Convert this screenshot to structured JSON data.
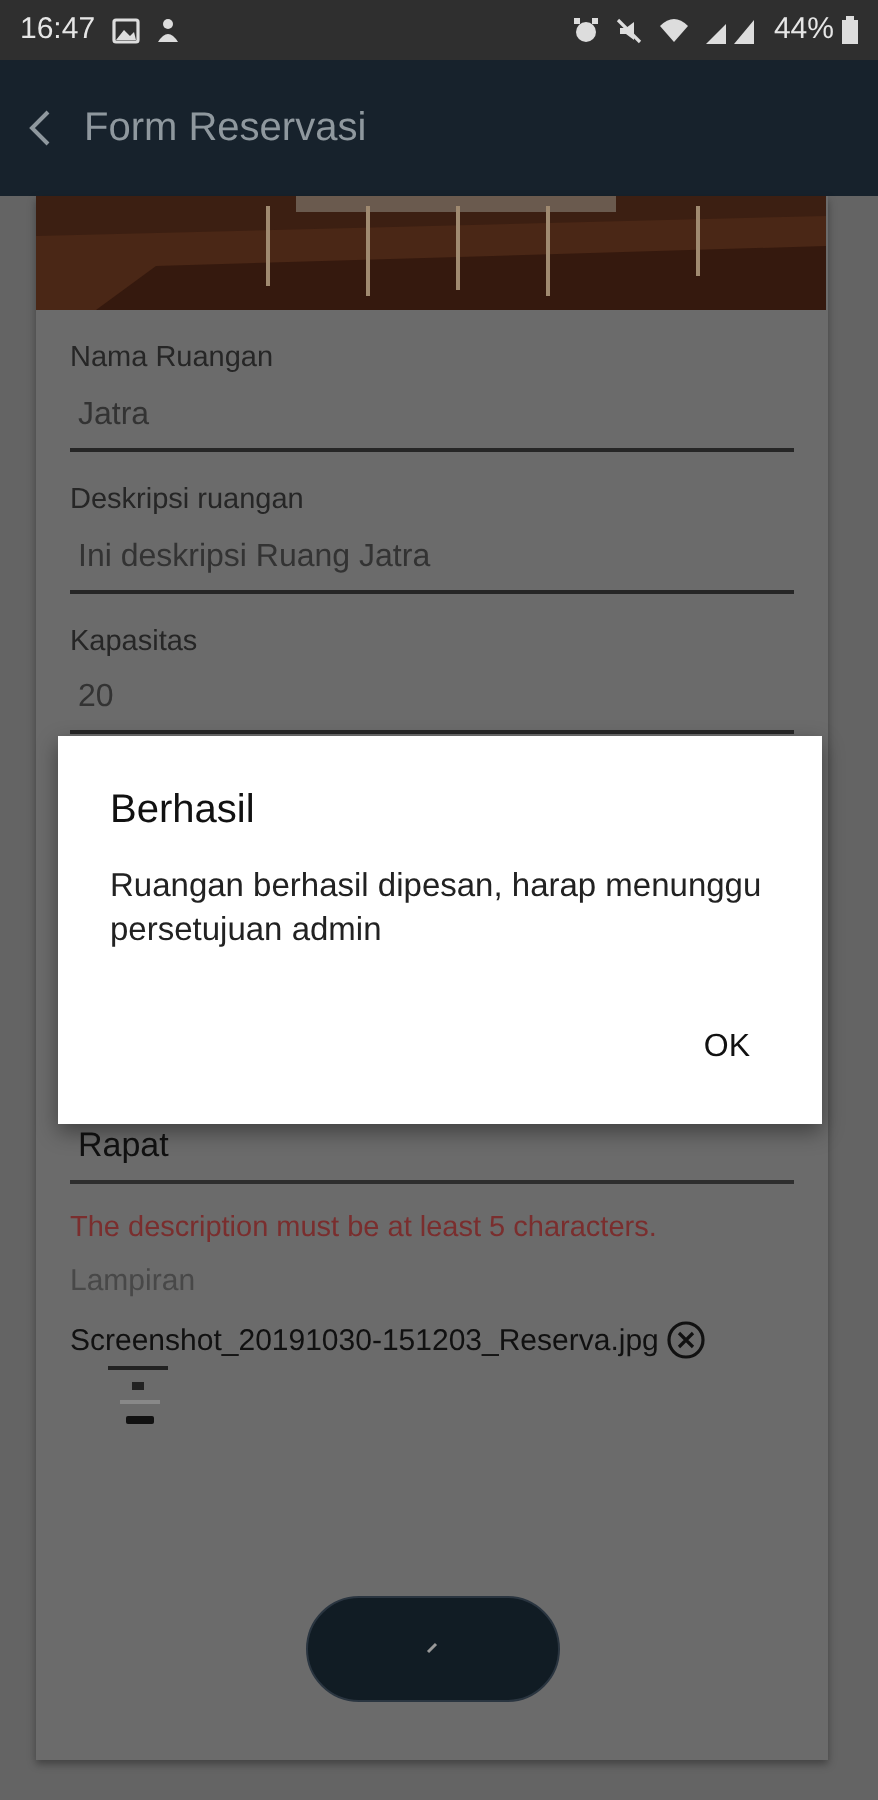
{
  "status_bar": {
    "time": "16:47",
    "battery": "44%"
  },
  "app_bar": {
    "title": "Form Reservasi"
  },
  "form": {
    "fields": [
      {
        "label": "Nama Ruangan",
        "value": "Jatra",
        "disabled": true
      },
      {
        "label": "Deskripsi ruangan",
        "value": "Ini deskripsi Ruang Jatra",
        "disabled": true
      },
      {
        "label": "Kapasitas",
        "value": "20",
        "disabled": true
      }
    ],
    "purpose": {
      "value": "Rapat",
      "disabled": false,
      "error": "The description must be at least 5 characters."
    },
    "attachment": {
      "label": "Lampiran",
      "filename": "Screenshot_20191030-151203_Reserva.jpg"
    }
  },
  "dialog": {
    "title": "Berhasil",
    "message": "Ruangan berhasil dipesan, harap menunggu persetujuan admin",
    "button": "OK"
  }
}
